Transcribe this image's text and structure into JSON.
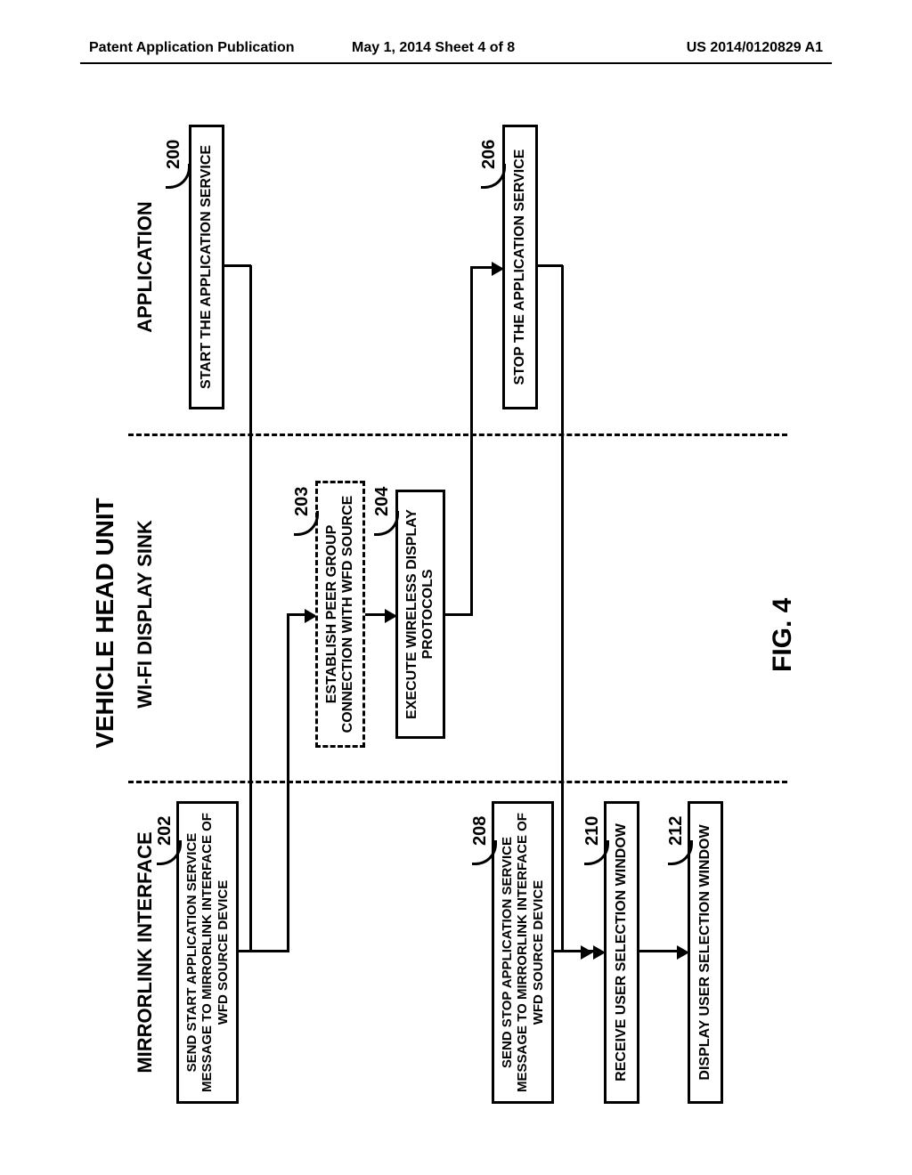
{
  "header": {
    "left": "Patent Application Publication",
    "middle": "May 1, 2014  Sheet 4 of 8",
    "right": "US 2014/0120829 A1"
  },
  "diagram": {
    "title": "VEHICLE HEAD UNIT",
    "lanes": {
      "mirrorlink": "MIRRORLINK INTERFACE",
      "sink": "WI-FI DISPLAY SINK",
      "app": "APPLICATION"
    },
    "refs": {
      "r200": "200",
      "r202": "202",
      "r203": "203",
      "r204": "204",
      "r206": "206",
      "r208": "208",
      "r210": "210",
      "r212": "212"
    },
    "boxes": {
      "b200": "START THE APPLICATION SERVICE",
      "b202": "SEND START APPLICATION SERVICE MESSAGE TO MIRRORLINK INTERFACE OF WFD SOURCE DEVICE",
      "b203": "ESTABLISH PEER GROUP CONNECTION WITH WFD SOURCE",
      "b204": "EXECUTE WIRELESS DISPLAY PROTOCOLS",
      "b206": "STOP THE APPLICATION SERVICE",
      "b208": "SEND STOP APPLICATION SERVICE MESSAGE TO MIRRORLINK INTERFACE OF WFD SOURCE DEVICE",
      "b210": "RECEIVE USER SELECTION WINDOW",
      "b212": "DISPLAY USER SELECTION WINDOW"
    },
    "figure_label": "FIG. 4"
  }
}
